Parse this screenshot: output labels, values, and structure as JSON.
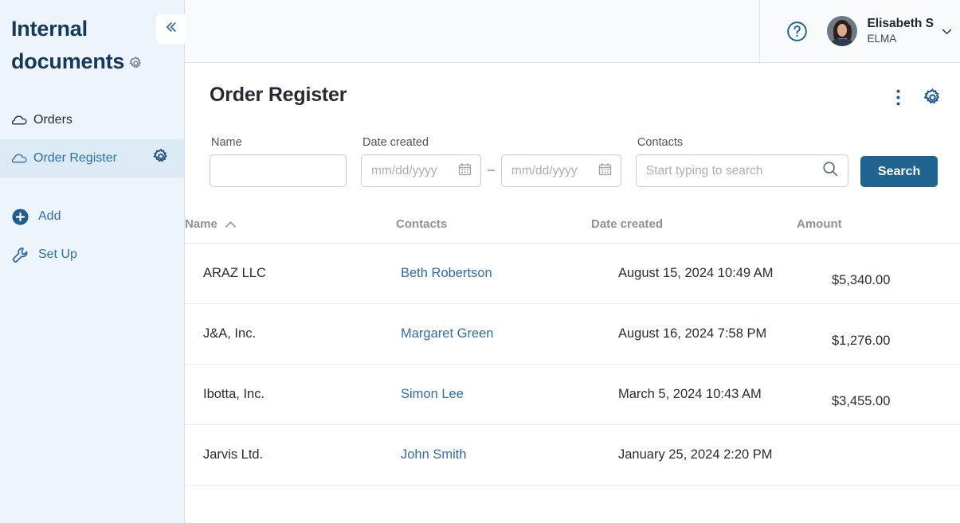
{
  "sidebar": {
    "title": "Internal documents",
    "title_gear_icon": "gear-icon",
    "collapse_icon": "double-chevron-left-icon",
    "items": [
      {
        "label": "Orders",
        "icon": "cloud-icon",
        "active": false,
        "has_gear": false
      },
      {
        "label": "Order Register",
        "icon": "cloud-icon",
        "active": true,
        "has_gear": true,
        "gear_icon": "gear-icon"
      }
    ],
    "actions": [
      {
        "label": "Add",
        "icon": "plus-circle-icon"
      },
      {
        "label": "Set Up",
        "icon": "wrench-icon"
      }
    ],
    "bg_color": "#eef4fb",
    "active_bg_color": "#dceaf5",
    "link_color": "#2f6ca8"
  },
  "topbar": {
    "help_icon": "question-circle-icon",
    "avatar": "user-avatar",
    "user_name": "Elisabeth S",
    "user_org": "ELMA",
    "caret_icon": "chevron-down-icon"
  },
  "page": {
    "title": "Order Register",
    "kebab_icon": "more-vertical-icon",
    "settings_icon": "gear-icon",
    "accent_color": "#1f6391"
  },
  "filters": {
    "name": {
      "label": "Name",
      "value": "",
      "placeholder": ""
    },
    "date_created": {
      "label": "Date created",
      "from_placeholder": "mm/dd/yyyy",
      "to_placeholder": "mm/dd/yyyy",
      "from_value": "",
      "to_value": "",
      "separator": "–",
      "calendar_icon": "calendar-icon"
    },
    "contacts": {
      "label": "Contacts",
      "placeholder": "Start typing to search",
      "value": "",
      "search_icon": "magnifier-icon"
    },
    "search_button": "Search"
  },
  "table": {
    "columns": [
      {
        "key": "name",
        "label": "Name",
        "sorted": "asc",
        "sort_icon": "chevron-up-icon"
      },
      {
        "key": "contacts",
        "label": "Contacts",
        "sorted": null
      },
      {
        "key": "date_created",
        "label": "Date created",
        "sorted": null
      },
      {
        "key": "amount",
        "label": "Amount",
        "sorted": null
      }
    ],
    "rows": [
      {
        "name": "ARAZ LLC",
        "contacts": "Beth Robertson",
        "date_created": "August 15, 2024 10:49 AM",
        "amount": "$5,340.00"
      },
      {
        "name": "J&A, Inc.",
        "contacts": "Margaret Green",
        "date_created": "August 16, 2024 7:58 PM",
        "amount": "$1,276.00"
      },
      {
        "name": "Ibotta, Inc.",
        "contacts": "Simon Lee",
        "date_created": "March 5, 2024 10:43 AM",
        "amount": "$3,455.00"
      },
      {
        "name": "Jarvis Ltd.",
        "contacts": "John Smith",
        "date_created": "January 25, 2024 2:20 PM",
        "amount": ""
      }
    ]
  }
}
